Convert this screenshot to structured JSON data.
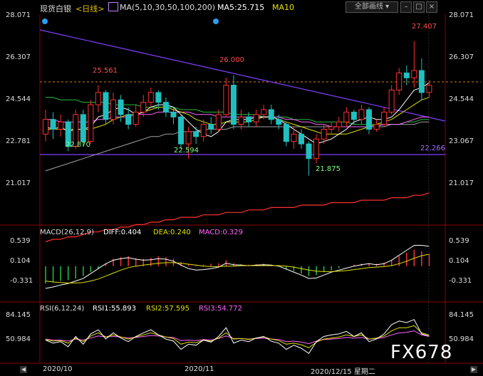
{
  "header": {
    "instrument": "现货白银",
    "period": "<日线>",
    "ma_label": "MA(5,10,30,50,100,200)",
    "ma5": "MA5:25.715",
    "ma10": "MA10",
    "dropdown": "全部画线",
    "colors": {
      "instrument": "#dddddd",
      "period": "#e0c000",
      "ma_label": "#dddddd",
      "ma5": "#ffffff",
      "ma10": "#e0e000"
    }
  },
  "price_axis": {
    "left": [
      "28.071",
      "26.307",
      "24.544",
      "22.781",
      "21.017"
    ],
    "right": [
      "28.071",
      "26.307",
      "24.544",
      "23.067",
      "21.017"
    ]
  },
  "price_annotations": {
    "high": "27.407",
    "a": "26.000",
    "b": "25.561",
    "c": "22.870",
    "d": "22.594",
    "e": "21.875",
    "line_level": "22.266"
  },
  "macd": {
    "title": "MACD(26,12,9)",
    "diff": "DIFF:0.404",
    "dea": "DEA:0.240",
    "macd": "MACD:0.329",
    "axis_left": [
      "0.539",
      "0.104",
      "-0.331"
    ],
    "axis_right": [
      "0.539",
      "0.104",
      "-0.331"
    ]
  },
  "rsi": {
    "title": "RSI(6,12,24)",
    "rsi1": "RSI1:55.893",
    "rsi2": "RSI2:57.595",
    "rsi3": "RSI3:54.772",
    "axis_left": [
      "84.145",
      "50.984"
    ],
    "axis_right": [
      "84.145",
      "50.984"
    ]
  },
  "time_axis": {
    "labels": [
      "2020/10",
      "2020/11",
      "2020/12/15 星期二"
    ]
  },
  "watermark": "FX678",
  "chart_data": {
    "type": "candlestick",
    "price_range": [
      20.0,
      28.5
    ],
    "candles": [
      {
        "o": 23.6,
        "c": 24.2,
        "h": 24.6,
        "l": 23.3
      },
      {
        "o": 24.2,
        "c": 23.8,
        "h": 24.5,
        "l": 23.4
      },
      {
        "o": 23.8,
        "c": 24.1,
        "h": 24.4,
        "l": 23.5
      },
      {
        "o": 24.1,
        "c": 23.1,
        "h": 24.2,
        "l": 22.9
      },
      {
        "o": 23.1,
        "c": 24.4,
        "h": 24.6,
        "l": 23.0
      },
      {
        "o": 24.4,
        "c": 23.3,
        "h": 24.6,
        "l": 23.1
      },
      {
        "o": 23.3,
        "c": 24.8,
        "h": 25.0,
        "l": 23.2
      },
      {
        "o": 24.8,
        "c": 25.3,
        "h": 25.6,
        "l": 24.5
      },
      {
        "o": 25.3,
        "c": 24.2,
        "h": 25.4,
        "l": 24.0
      },
      {
        "o": 24.2,
        "c": 25.0,
        "h": 25.3,
        "l": 24.0
      },
      {
        "o": 25.0,
        "c": 24.4,
        "h": 25.2,
        "l": 24.1
      },
      {
        "o": 24.4,
        "c": 24.0,
        "h": 24.7,
        "l": 23.8
      },
      {
        "o": 24.0,
        "c": 24.5,
        "h": 24.8,
        "l": 23.9
      },
      {
        "o": 24.5,
        "c": 24.9,
        "h": 25.2,
        "l": 24.3
      },
      {
        "o": 24.9,
        "c": 25.3,
        "h": 25.5,
        "l": 24.7
      },
      {
        "o": 25.3,
        "c": 24.9,
        "h": 25.4,
        "l": 24.6
      },
      {
        "o": 24.9,
        "c": 24.5,
        "h": 25.1,
        "l": 24.3
      },
      {
        "o": 24.5,
        "c": 24.3,
        "h": 24.7,
        "l": 24.0
      },
      {
        "o": 24.3,
        "c": 23.2,
        "h": 24.4,
        "l": 23.0
      },
      {
        "o": 23.2,
        "c": 23.7,
        "h": 23.9,
        "l": 22.6
      },
      {
        "o": 23.7,
        "c": 23.5,
        "h": 23.9,
        "l": 23.2
      },
      {
        "o": 23.5,
        "c": 24.0,
        "h": 24.2,
        "l": 23.3
      },
      {
        "o": 24.0,
        "c": 23.8,
        "h": 24.3,
        "l": 23.6
      },
      {
        "o": 23.8,
        "c": 24.4,
        "h": 24.6,
        "l": 23.7
      },
      {
        "o": 24.4,
        "c": 25.6,
        "h": 25.9,
        "l": 24.3
      },
      {
        "o": 25.6,
        "c": 24.0,
        "h": 26.0,
        "l": 23.8
      },
      {
        "o": 24.0,
        "c": 24.3,
        "h": 24.6,
        "l": 23.8
      },
      {
        "o": 24.3,
        "c": 24.1,
        "h": 24.5,
        "l": 23.9
      },
      {
        "o": 24.1,
        "c": 24.4,
        "h": 24.6,
        "l": 23.9
      },
      {
        "o": 24.4,
        "c": 24.6,
        "h": 24.8,
        "l": 24.2
      },
      {
        "o": 24.6,
        "c": 24.2,
        "h": 24.8,
        "l": 24.0
      },
      {
        "o": 24.2,
        "c": 24.0,
        "h": 24.4,
        "l": 23.8
      },
      {
        "o": 24.0,
        "c": 23.3,
        "h": 24.1,
        "l": 23.1
      },
      {
        "o": 23.3,
        "c": 23.6,
        "h": 23.9,
        "l": 23.0
      },
      {
        "o": 23.6,
        "c": 23.2,
        "h": 23.8,
        "l": 23.0
      },
      {
        "o": 23.2,
        "c": 22.6,
        "h": 23.3,
        "l": 21.9
      },
      {
        "o": 22.6,
        "c": 23.4,
        "h": 23.6,
        "l": 22.4
      },
      {
        "o": 23.4,
        "c": 23.8,
        "h": 24.0,
        "l": 23.2
      },
      {
        "o": 23.8,
        "c": 23.9,
        "h": 24.1,
        "l": 23.6
      },
      {
        "o": 23.9,
        "c": 24.1,
        "h": 24.3,
        "l": 23.7
      },
      {
        "o": 24.1,
        "c": 24.5,
        "h": 24.7,
        "l": 23.9
      },
      {
        "o": 24.5,
        "c": 24.2,
        "h": 24.6,
        "l": 24.0
      },
      {
        "o": 24.2,
        "c": 24.6,
        "h": 24.8,
        "l": 24.0
      },
      {
        "o": 24.6,
        "c": 23.8,
        "h": 24.7,
        "l": 23.6
      },
      {
        "o": 23.8,
        "c": 24.0,
        "h": 24.2,
        "l": 23.7
      },
      {
        "o": 24.0,
        "c": 24.5,
        "h": 24.7,
        "l": 23.9
      },
      {
        "o": 24.5,
        "c": 25.4,
        "h": 25.6,
        "l": 24.4
      },
      {
        "o": 25.4,
        "c": 26.1,
        "h": 26.3,
        "l": 25.2
      },
      {
        "o": 26.1,
        "c": 25.9,
        "h": 26.4,
        "l": 25.6
      },
      {
        "o": 25.9,
        "c": 26.2,
        "h": 27.4,
        "l": 25.5
      },
      {
        "o": 26.2,
        "c": 25.3,
        "h": 26.7,
        "l": 25.0
      },
      {
        "o": 25.3,
        "c": 25.6,
        "h": 25.8,
        "l": 25.1
      }
    ],
    "ma5": [
      23.9,
      23.8,
      23.9,
      23.7,
      23.8,
      23.8,
      23.9,
      24.3,
      24.4,
      24.6,
      24.7,
      24.6,
      24.4,
      24.5,
      24.7,
      24.8,
      24.8,
      24.7,
      24.4,
      24.1,
      23.8,
      23.6,
      23.5,
      23.7,
      24.1,
      24.2,
      24.2,
      24.2,
      24.3,
      24.3,
      24.3,
      24.2,
      24.0,
      23.8,
      23.6,
      23.4,
      23.2,
      23.3,
      23.4,
      23.6,
      23.8,
      24.1,
      24.2,
      24.3,
      24.2,
      24.2,
      24.3,
      24.6,
      25.0,
      25.4,
      25.5,
      25.7
    ],
    "ma10": [
      23.8,
      23.8,
      23.8,
      23.8,
      23.8,
      23.8,
      23.8,
      23.9,
      24.0,
      24.2,
      24.3,
      24.4,
      24.4,
      24.5,
      24.6,
      24.7,
      24.7,
      24.6,
      24.5,
      24.4,
      24.2,
      24.1,
      24.0,
      24.0,
      24.1,
      24.1,
      24.1,
      24.1,
      24.2,
      24.3,
      24.3,
      24.2,
      24.1,
      24.0,
      23.9,
      23.8,
      23.7,
      23.6,
      23.6,
      23.6,
      23.6,
      23.7,
      23.8,
      23.9,
      24.0,
      24.1,
      24.2,
      24.4,
      24.6,
      24.8,
      25.0,
      25.1
    ],
    "ma30": [
      24.2,
      24.2,
      24.1,
      24.1,
      24.1,
      24.1,
      24.1,
      24.2,
      24.2,
      24.3,
      24.3,
      24.3,
      24.4,
      24.4,
      24.4,
      24.5,
      24.5,
      24.5,
      24.5,
      24.5,
      24.4,
      24.4,
      24.4,
      24.3,
      24.3,
      24.3,
      24.3,
      24.3,
      24.3,
      24.3,
      24.3,
      24.3,
      24.2,
      24.2,
      24.1,
      24.1,
      24.0,
      24.0,
      23.9,
      23.9,
      23.9,
      23.9,
      23.9,
      23.9,
      23.9,
      24.0,
      24.0,
      24.0,
      24.1,
      24.2,
      24.3,
      24.3
    ],
    "ma50": [
      25.1,
      25.1,
      25.0,
      25.0,
      25.0,
      24.9,
      24.9,
      24.9,
      24.9,
      24.8,
      24.8,
      24.8,
      24.8,
      24.7,
      24.7,
      24.7,
      24.7,
      24.7,
      24.6,
      24.6,
      24.6,
      24.5,
      24.5,
      24.5,
      24.5,
      24.4,
      24.4,
      24.4,
      24.4,
      24.3,
      24.3,
      24.3,
      24.3,
      24.2,
      24.2,
      24.2,
      24.1,
      24.1,
      24.1,
      24.1,
      24.1,
      24.0,
      24.0,
      24.0,
      24.0,
      24.0,
      24.0,
      24.0,
      24.1,
      24.1,
      24.2,
      24.2
    ],
    "ma100": [
      22.1,
      22.2,
      22.3,
      22.4,
      22.5,
      22.6,
      22.7,
      22.8,
      22.9,
      23.0,
      23.1,
      23.2,
      23.3,
      23.4,
      23.5,
      23.5,
      23.6,
      23.6,
      23.7,
      23.7,
      23.7,
      23.8,
      23.8,
      23.8,
      23.8,
      23.9,
      23.9,
      23.9,
      23.9,
      23.9,
      23.9,
      23.9,
      23.9,
      23.9,
      23.9,
      23.9,
      23.9,
      23.9,
      23.9,
      23.9,
      23.9,
      23.9,
      23.9,
      23.9,
      23.9,
      23.9,
      24.0,
      24.0,
      24.0,
      24.0,
      24.1,
      24.1
    ],
    "ma200": [
      19.2,
      19.3,
      19.3,
      19.4,
      19.4,
      19.5,
      19.6,
      19.6,
      19.7,
      19.7,
      19.8,
      19.8,
      19.9,
      19.9,
      20.0,
      20.0,
      20.1,
      20.1,
      20.2,
      20.2,
      20.2,
      20.3,
      20.3,
      20.3,
      20.4,
      20.4,
      20.4,
      20.5,
      20.5,
      20.5,
      20.6,
      20.6,
      20.6,
      20.6,
      20.7,
      20.7,
      20.7,
      20.7,
      20.8,
      20.8,
      20.8,
      20.8,
      20.9,
      20.9,
      20.9,
      20.9,
      21.0,
      21.0,
      21.0,
      21.1,
      21.1,
      21.2
    ],
    "macd_range": [
      -0.55,
      0.6
    ],
    "macd_hist": [
      -0.35,
      -0.33,
      -0.3,
      -0.28,
      -0.25,
      -0.2,
      -0.12,
      -0.05,
      0.05,
      0.15,
      0.18,
      0.2,
      0.16,
      0.15,
      0.17,
      0.2,
      0.18,
      0.15,
      0.08,
      0.04,
      0.02,
      0.03,
      0.05,
      0.06,
      0.12,
      0.06,
      0.04,
      0.03,
      0.04,
      0.05,
      0.03,
      0.0,
      -0.05,
      -0.1,
      -0.15,
      -0.2,
      -0.18,
      -0.12,
      -0.08,
      -0.04,
      0.0,
      0.03,
      0.05,
      0.06,
      0.05,
      0.07,
      0.12,
      0.2,
      0.27,
      0.33,
      0.3,
      0.25
    ],
    "macd_diff": [
      -0.45,
      -0.42,
      -0.38,
      -0.35,
      -0.3,
      -0.25,
      -0.15,
      -0.05,
      0.05,
      0.12,
      0.15,
      0.17,
      0.14,
      0.12,
      0.13,
      0.15,
      0.14,
      0.1,
      0.02,
      -0.05,
      -0.08,
      -0.07,
      -0.05,
      -0.02,
      0.06,
      0.03,
      0.02,
      0.01,
      0.02,
      0.03,
      0.02,
      0.0,
      -0.06,
      -0.12,
      -0.18,
      -0.25,
      -0.24,
      -0.18,
      -0.12,
      -0.08,
      -0.04,
      0.0,
      0.03,
      0.05,
      0.03,
      0.05,
      0.12,
      0.22,
      0.32,
      0.42,
      0.42,
      0.4
    ],
    "macd_dea": [
      -0.3,
      -0.32,
      -0.33,
      -0.34,
      -0.34,
      -0.33,
      -0.3,
      -0.26,
      -0.2,
      -0.14,
      -0.08,
      -0.03,
      0.0,
      0.02,
      0.04,
      0.06,
      0.07,
      0.07,
      0.06,
      0.04,
      0.02,
      0.0,
      -0.01,
      -0.01,
      0.0,
      0.0,
      0.01,
      0.01,
      0.01,
      0.01,
      0.01,
      0.01,
      0.0,
      -0.02,
      -0.05,
      -0.08,
      -0.1,
      -0.11,
      -0.11,
      -0.1,
      -0.09,
      -0.07,
      -0.05,
      -0.03,
      -0.02,
      -0.01,
      0.01,
      0.05,
      0.1,
      0.16,
      0.21,
      0.24
    ],
    "rsi_range": [
      10,
      100
    ],
    "rsi1": [
      48,
      42,
      45,
      35,
      55,
      40,
      60,
      68,
      50,
      62,
      52,
      45,
      55,
      62,
      68,
      58,
      50,
      46,
      30,
      40,
      38,
      48,
      44,
      55,
      72,
      42,
      48,
      45,
      52,
      55,
      46,
      42,
      30,
      38,
      32,
      22,
      45,
      55,
      58,
      60,
      65,
      55,
      62,
      45,
      50,
      60,
      78,
      85,
      82,
      88,
      60,
      56
    ],
    "rsi2": [
      49,
      46,
      47,
      42,
      52,
      45,
      56,
      62,
      54,
      58,
      54,
      50,
      54,
      58,
      62,
      58,
      54,
      51,
      40,
      44,
      43,
      48,
      46,
      52,
      62,
      50,
      51,
      49,
      52,
      54,
      50,
      47,
      40,
      42,
      39,
      33,
      44,
      50,
      52,
      54,
      58,
      55,
      58,
      50,
      52,
      56,
      66,
      72,
      72,
      76,
      62,
      58
    ],
    "rsi3": [
      50,
      48,
      48,
      46,
      50,
      48,
      52,
      56,
      54,
      55,
      54,
      52,
      53,
      55,
      57,
      56,
      54,
      53,
      47,
      48,
      47,
      49,
      48,
      51,
      56,
      51,
      51,
      50,
      51,
      52,
      50,
      49,
      45,
      46,
      44,
      41,
      46,
      49,
      50,
      51,
      53,
      52,
      53,
      50,
      51,
      53,
      58,
      62,
      63,
      66,
      58,
      55
    ]
  }
}
